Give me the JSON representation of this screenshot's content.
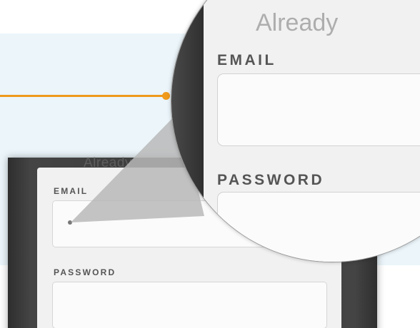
{
  "form": {
    "heading": "Already",
    "email_label": "EMAIL",
    "password_label": "PASSWORD"
  },
  "colors": {
    "backdrop": "#ebf5fa",
    "callout": "#ef9a1c",
    "device_frame": "#3b3b3b",
    "panel": "#f1f1f1"
  }
}
